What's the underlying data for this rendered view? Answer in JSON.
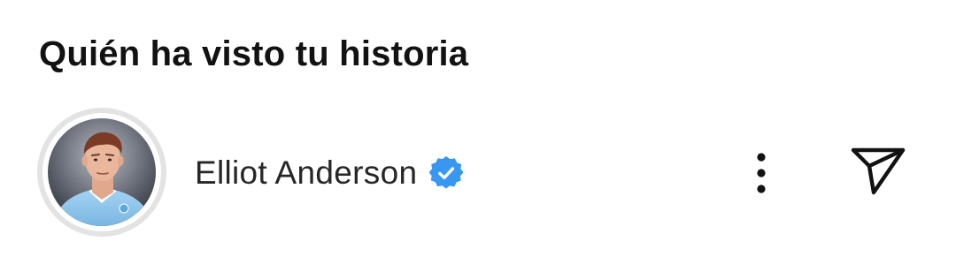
{
  "header": {
    "title": "Quién ha visto tu historia"
  },
  "viewers": [
    {
      "username": "Elliot Anderson",
      "verified": true,
      "avatar_icon": "profile-photo",
      "more_icon": "more-vertical-icon",
      "send_icon": "paper-plane-icon"
    }
  ],
  "colors": {
    "text_primary": "#121212",
    "verified_badge": "#3897f0",
    "ring": "#e3e3e3",
    "jersey": "#8fc4ea"
  }
}
